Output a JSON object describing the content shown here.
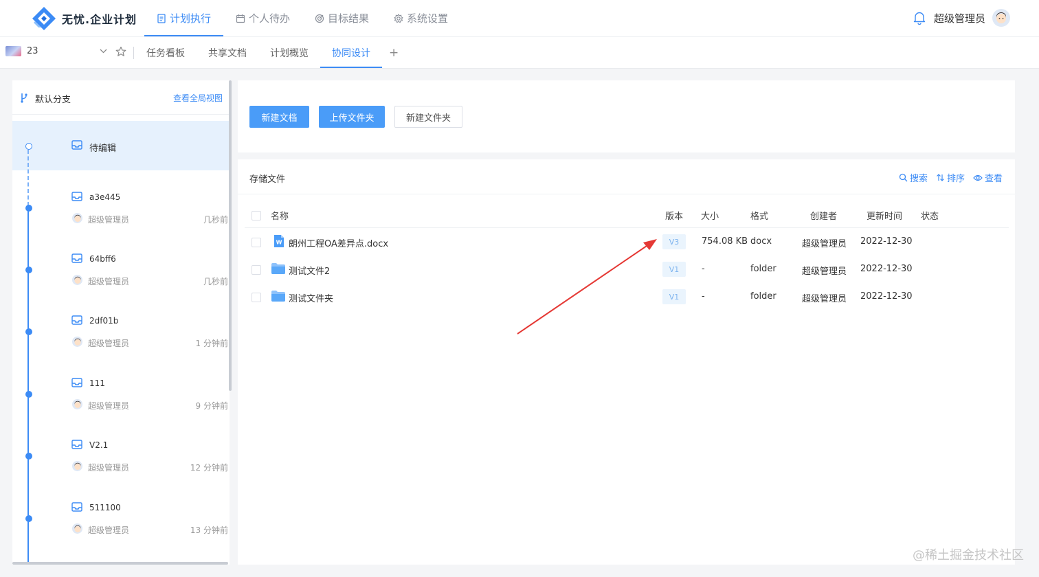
{
  "header": {
    "brand": "无忧.企业计划",
    "nav": [
      {
        "label": "计划执行",
        "icon": "document-icon",
        "active": true
      },
      {
        "label": "个人待办",
        "icon": "calendar-icon",
        "active": false
      },
      {
        "label": "目标结果",
        "icon": "target-icon",
        "active": false
      },
      {
        "label": "系统设置",
        "icon": "gear-icon",
        "active": false
      }
    ],
    "user_name": "超级管理员"
  },
  "subheader": {
    "project_number": "23",
    "tabs": [
      {
        "label": "任务看板",
        "active": false
      },
      {
        "label": "共享文档",
        "active": false
      },
      {
        "label": "计划概览",
        "active": false
      },
      {
        "label": "协同设计",
        "active": true
      }
    ],
    "add_label": "+"
  },
  "branch_panel": {
    "branch_label": "默认分支",
    "view_all_label": "查看全局视图",
    "draft_label": "待编辑",
    "commits": [
      {
        "name": "a3e445",
        "author": "超级管理员",
        "time": "几秒前"
      },
      {
        "name": "64bff6",
        "author": "超级管理员",
        "time": "几秒前"
      },
      {
        "name": "2df01b",
        "author": "超级管理员",
        "time": "1 分钟前"
      },
      {
        "name": "111",
        "author": "超级管理员",
        "time": "9 分钟前"
      },
      {
        "name": "V2.1",
        "author": "超级管理员",
        "time": "12 分钟前"
      },
      {
        "name": "511100",
        "author": "超级管理员",
        "time": "13 分钟前"
      }
    ]
  },
  "actions": {
    "new_doc": "新建文档",
    "upload_folder": "上传文件夹",
    "new_folder": "新建文件夹"
  },
  "files": {
    "title": "存储文件",
    "tools": {
      "search": "搜索",
      "sort": "排序",
      "view": "查看"
    },
    "columns": {
      "name": "名称",
      "version": "版本",
      "size": "大小",
      "format": "格式",
      "creator": "创建者",
      "updated": "更新时间",
      "status": "状态"
    },
    "rows": [
      {
        "type": "word",
        "name": "朗州工程OA差异点.docx",
        "version": "V3",
        "size": "754.08 KB",
        "format": "docx",
        "creator": "超级管理员",
        "updated": "2022-12-30",
        "status": ""
      },
      {
        "type": "folder",
        "name": "测试文件2",
        "version": "V1",
        "size": "-",
        "format": "folder",
        "creator": "超级管理员",
        "updated": "2022-12-30",
        "status": ""
      },
      {
        "type": "folder",
        "name": "测试文件夹",
        "version": "V1",
        "size": "-",
        "format": "folder",
        "creator": "超级管理员",
        "updated": "2022-12-30",
        "status": ""
      }
    ]
  },
  "colors": {
    "accent": "#3c8bf5",
    "button_primary": "#4a9cf8",
    "annotation_arrow": "#e53935",
    "draft_bg": "#e6f1fd"
  },
  "watermark": "@稀土掘金技术社区"
}
